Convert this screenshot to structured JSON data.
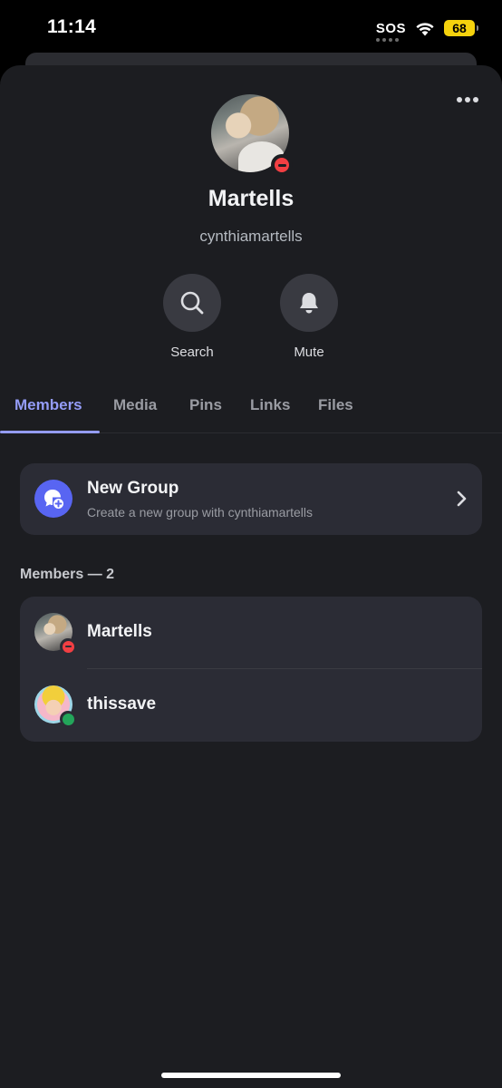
{
  "status_bar": {
    "time": "11:14",
    "sos": "SOS",
    "battery": "68",
    "icons": [
      "wifi-icon",
      "battery-icon"
    ]
  },
  "profile": {
    "display_name": "Martells",
    "username": "cynthiamartells",
    "status": "dnd",
    "more_icon": "more-horizontal-icon"
  },
  "actions": [
    {
      "label": "Search",
      "icon": "search-icon"
    },
    {
      "label": "Mute",
      "icon": "bell-icon"
    }
  ],
  "tabs": [
    {
      "label": "Members",
      "active": true
    },
    {
      "label": "Media",
      "active": false
    },
    {
      "label": "Pins",
      "active": false
    },
    {
      "label": "Links",
      "active": false
    },
    {
      "label": "Files",
      "active": false
    }
  ],
  "new_group": {
    "title": "New Group",
    "subtitle": "Create a new group with cynthiamartells",
    "icon": "new-group-icon"
  },
  "members": {
    "header": "Members — 2",
    "list": [
      {
        "name": "Martells",
        "status": "dnd"
      },
      {
        "name": "thissave",
        "status": "online"
      }
    ]
  },
  "colors": {
    "background": "#1c1d21",
    "card": "#2b2c35",
    "accent": "#949cf7",
    "blurple": "#5865f2",
    "dnd": "#f23f43",
    "online": "#23a55a"
  }
}
